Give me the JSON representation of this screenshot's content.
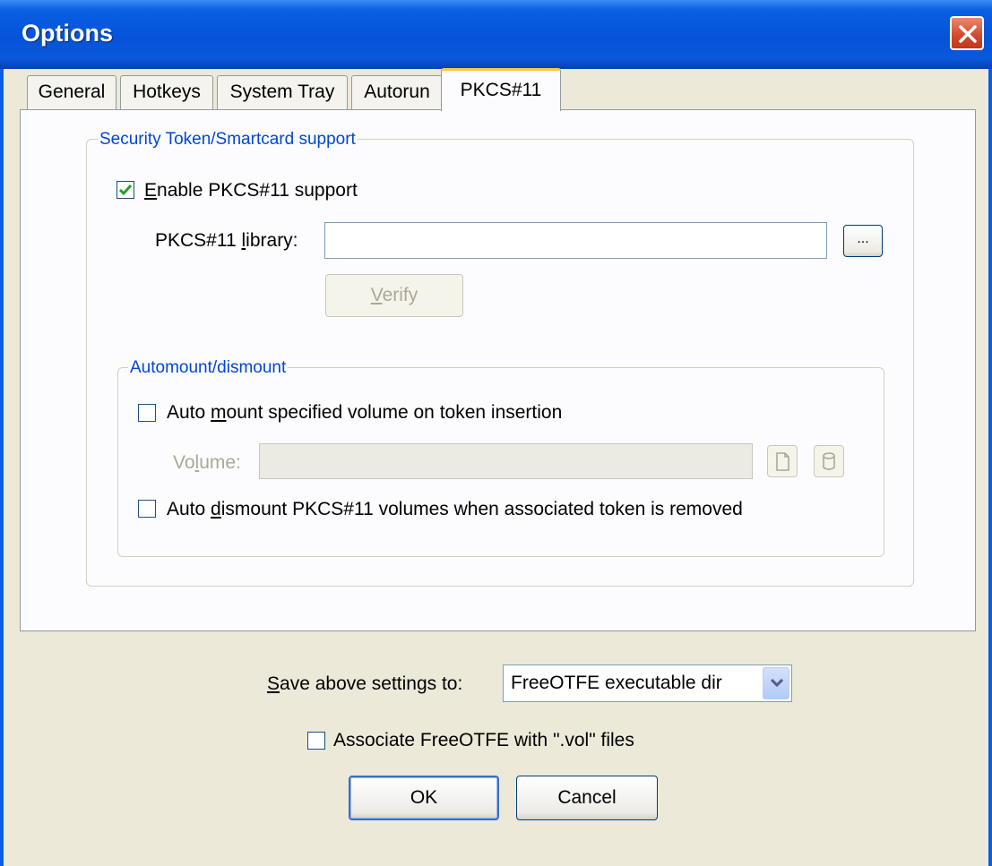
{
  "window": {
    "title": "Options"
  },
  "tabs": [
    {
      "label": "General"
    },
    {
      "label": "Hotkeys"
    },
    {
      "label": "System Tray"
    },
    {
      "label": "Autorun"
    },
    {
      "label": "PKCS#11"
    }
  ],
  "active_tab": "PKCS#11",
  "security_group": {
    "label": "Security Token/Smartcard support",
    "enable": {
      "label_first": "E",
      "label_rest": "nable PKCS#11 support",
      "checked": true
    },
    "library": {
      "label_pre": "PKCS#11 ",
      "label_u": "l",
      "label_post": "ibrary:",
      "value": "",
      "browse_label": "..."
    },
    "verify": {
      "label_u": "V",
      "label_rest": "erify",
      "enabled": false
    }
  },
  "automount_group": {
    "label": "Automount/dismount",
    "auto_mount": {
      "label_pre": "Auto ",
      "label_u": "m",
      "label_post": "ount specified volume on token insertion",
      "checked": false
    },
    "volume": {
      "label_pre": "Vo",
      "label_u": "l",
      "label_post": "ume:",
      "value": "",
      "enabled": false
    },
    "auto_dismount": {
      "label_pre": "Auto ",
      "label_u": "d",
      "label_post": "ismount PKCS#11 volumes when associated token is removed",
      "checked": false
    }
  },
  "bottom": {
    "save": {
      "label_u": "S",
      "label_rest": "ave above settings to:",
      "selected": "FreeOTFE executable dir"
    },
    "associate": {
      "label": "Associate FreeOTFE with \".vol\" files",
      "checked": false
    },
    "ok_label": "OK",
    "cancel_label": "Cancel"
  },
  "colors": {
    "titlebar": "#0553D9",
    "group_label": "#0046D5",
    "active_tab_accent": "#FFC83C",
    "face": "#ECE9D8"
  }
}
